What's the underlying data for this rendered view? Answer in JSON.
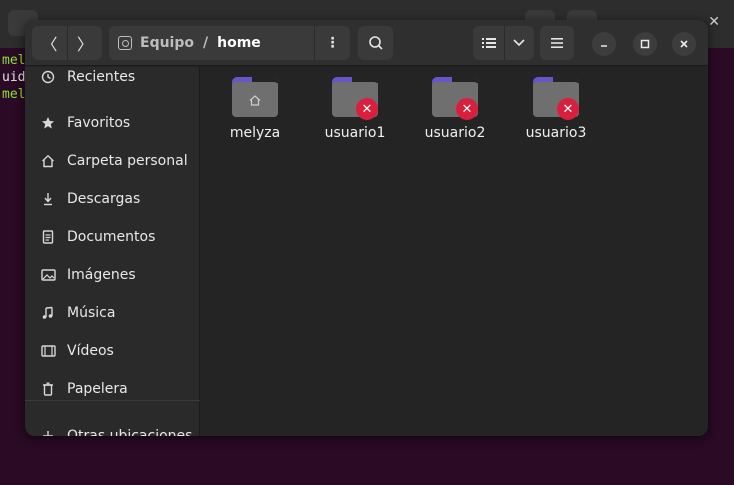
{
  "terminal": {
    "lines": [
      {
        "text": "mel",
        "color": "#8ae234"
      },
      {
        "text": "uid",
        "color": "#e8e8e8"
      },
      {
        "text": "mel",
        "color": "#8ae234"
      }
    ]
  },
  "header": {
    "back_icon": "〈",
    "forward_icon": "〉",
    "path": {
      "segment1": "Equipo",
      "separator": "/",
      "segment2": "home"
    },
    "path_menu_icon": "⋮",
    "search_icon": "⌕",
    "view_list_icon": "☷",
    "view_dropdown_icon": "⌄",
    "main_menu_icon": "≡",
    "minimize_icon": "—",
    "maximize_icon": "□",
    "close_icon": "✕"
  },
  "sidebar": {
    "items": [
      {
        "label": "Recientes",
        "icon": "clock"
      },
      {
        "label": "Favoritos",
        "icon": "star"
      },
      {
        "label": "Carpeta personal",
        "icon": "home"
      },
      {
        "label": "Descargas",
        "icon": "download"
      },
      {
        "label": "Documentos",
        "icon": "document"
      },
      {
        "label": "Imágenes",
        "icon": "image"
      },
      {
        "label": "Música",
        "icon": "music"
      },
      {
        "label": "Vídeos",
        "icon": "video"
      },
      {
        "label": "Papelera",
        "icon": "trash"
      },
      {
        "label": "Otras ubicaciones",
        "icon": "plus"
      }
    ]
  },
  "files": [
    {
      "name": "melyza",
      "type": "home"
    },
    {
      "name": "usuario1",
      "type": "locked"
    },
    {
      "name": "usuario2",
      "type": "locked"
    },
    {
      "name": "usuario3",
      "type": "locked"
    }
  ],
  "colors": {
    "accent": "#6a55c8",
    "error": "#d8203e"
  }
}
